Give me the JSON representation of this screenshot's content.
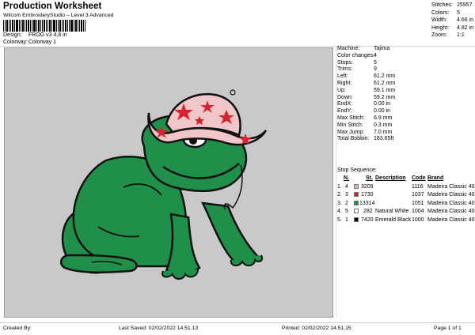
{
  "header": {
    "title": "Production Worksheet",
    "subtitle": "Wilcom EmbroideryStudio – Level 3 Advanced",
    "design_label": "Design:",
    "design_value": "FROG v3 4,8 in",
    "colorway_label": "Colorway:",
    "colorway_value": "Colorway 1"
  },
  "summary": [
    {
      "label": "Stitches:",
      "value": "25957"
    },
    {
      "label": "Colors:",
      "value": "5"
    },
    {
      "label": "Width:",
      "value": "4.66 in"
    },
    {
      "label": "Height:",
      "value": "4.82 in"
    },
    {
      "label": "Zoom:",
      "value": "1:1"
    }
  ],
  "stats": [
    {
      "label": "Machine:",
      "value": "Tajima"
    },
    {
      "label": "Color changes:",
      "value": "4"
    },
    {
      "label": "Stops:",
      "value": "5"
    },
    {
      "label": "Trims:",
      "value": "9"
    },
    {
      "label": "Left:",
      "value": "61.2 mm"
    },
    {
      "label": "Right:",
      "value": "61.2 mm"
    },
    {
      "label": "Up:",
      "value": "59.1 mm"
    },
    {
      "label": "Down:",
      "value": "59.2 mm"
    },
    {
      "label": "EndX:",
      "value": "0.00 in"
    },
    {
      "label": "EndY:",
      "value": "0.00 in"
    },
    {
      "label": "Max Stitch:",
      "value": "6.9 mm"
    },
    {
      "label": "Min Stitch:",
      "value": "0.3 mm"
    },
    {
      "label": "Max Jump:",
      "value": "7.0 mm"
    },
    {
      "label": "Total Bobbin:",
      "value": "183.65ft"
    }
  ],
  "sequence": {
    "title": "Stop Sequence:",
    "headers": {
      "n": "N.",
      "st": "St.",
      "description": "Description",
      "code": "Code",
      "brand": "Brand"
    },
    "rows": [
      {
        "stop": "1.",
        "n": "4",
        "color": "#e8b0b4",
        "st": "3209",
        "description": "",
        "code": "1116",
        "brand": "Madeira Classic 40"
      },
      {
        "stop": "2.",
        "n": "3",
        "color": "#cc1f2a",
        "st": "1730",
        "description": "",
        "code": "1037",
        "brand": "Madeira Classic 40"
      },
      {
        "stop": "3.",
        "n": "2",
        "color": "#138a4a",
        "st": "13314",
        "description": "",
        "code": "1051",
        "brand": "Madeira Classic 40"
      },
      {
        "stop": "4.",
        "n": "5",
        "color": "#ffffff",
        "st": "282",
        "description": "Natural White",
        "code": "1004",
        "brand": "Madeira Classic 40"
      },
      {
        "stop": "5.",
        "n": "1",
        "color": "#000000",
        "st": "7420",
        "description": "Emerald Black",
        "code": "1000",
        "brand": "Madeira Classic 40"
      }
    ]
  },
  "footer": {
    "created": "Created By:",
    "saved": "Last Saved: 02/02/2022 14.51.13",
    "printed": "Printed: 02/02/2022 14.51.15",
    "page": "Page 1 of 1"
  },
  "colors": {
    "frog_green": "#1f8f4a",
    "frog_dark": "#0f5a2c",
    "outline": "#111111",
    "hat_pink": "#f1c6c9",
    "hat_star": "#d5232f",
    "background": "#c9c9c9"
  }
}
